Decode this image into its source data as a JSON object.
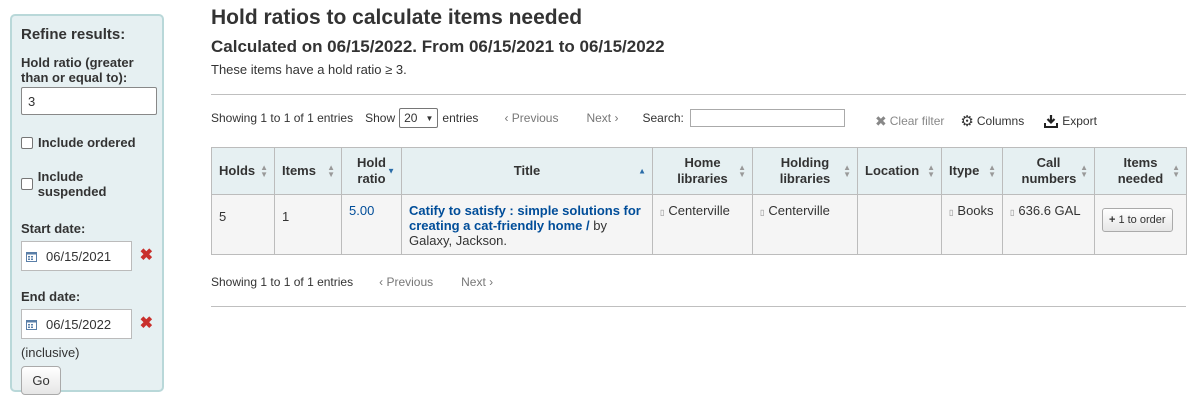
{
  "sidebar": {
    "heading": "Refine results:",
    "hold_ratio_label": "Hold ratio (greater than or equal to):",
    "hold_ratio_value": "3",
    "include_ordered": "Include ordered",
    "include_suspended": "Include suspended",
    "start_label": "Start date:",
    "start_value": "06/15/2021",
    "end_label": "End date:",
    "end_value": "06/15/2022",
    "inclusive": "(inclusive)",
    "go": "Go"
  },
  "main": {
    "title": "Hold ratios to calculate items needed",
    "subtitle": "Calculated on 06/15/2022. From 06/15/2021 to 06/15/2022",
    "note": "These items have a hold ratio ≥ 3."
  },
  "toolbar": {
    "info": "Showing 1 to 1 of 1 entries",
    "show": "Show",
    "page_size": "20",
    "entries": "entries",
    "previous": "Previous",
    "next": "Next",
    "search_label": "Search:",
    "clear_filter": "Clear filter",
    "columns": "Columns",
    "export": "Export"
  },
  "table": {
    "headers": {
      "holds": "Holds",
      "items": "Items",
      "hold_ratio": "Hold ratio",
      "title": "Title",
      "home_libraries": "Home libraries",
      "holding_libraries": "Holding libraries",
      "location": "Location",
      "itype": "Itype",
      "call_numbers": "Call numbers",
      "items_needed": "Items needed"
    },
    "row": {
      "holds": "5",
      "items": "1",
      "hold_ratio": "5.00",
      "title": "Catify to satisfy : simple solutions for creating a cat-friendly home /",
      "by": "by",
      "author": "Galaxy, Jackson.",
      "home_library": "Centerville",
      "holding_library": "Centerville",
      "location": "",
      "itype": "Books",
      "call_number": "636.6 GAL",
      "order_button": "1 to order"
    }
  },
  "footer": {
    "info": "Showing 1 to 1 of 1 entries",
    "previous": "Previous",
    "next": "Next"
  }
}
